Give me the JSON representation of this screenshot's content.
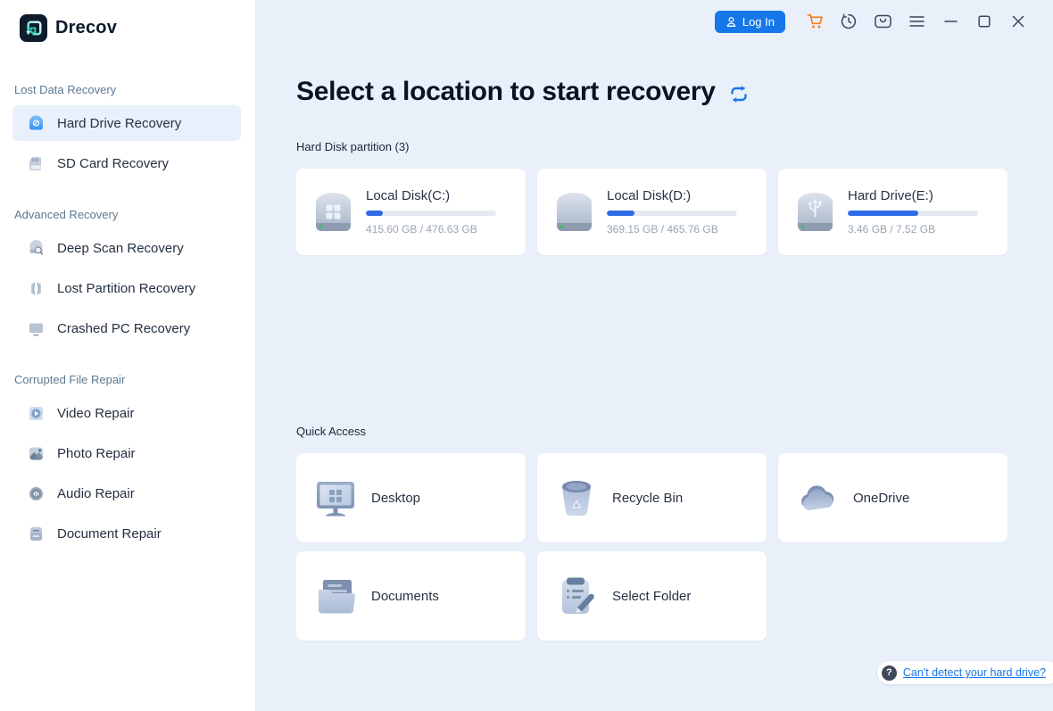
{
  "app": {
    "name": "Drecov"
  },
  "topbar": {
    "login": {
      "label": "Log In",
      "icon": "user-icon"
    },
    "icons": [
      {
        "name": "cart-icon",
        "color": "#f08119"
      },
      {
        "name": "history-clock-icon"
      },
      {
        "name": "messages-icon"
      },
      {
        "name": "menu-icon"
      },
      {
        "name": "minimize-icon"
      },
      {
        "name": "maximize-icon"
      },
      {
        "name": "close-icon"
      }
    ]
  },
  "sidebar": {
    "sections": [
      {
        "label": "Lost Data Recovery",
        "items": [
          {
            "label": "Hard Drive Recovery",
            "icon": "hard-drive-icon",
            "selected": true
          },
          {
            "label": "SD Card Recovery",
            "icon": "sd-card-icon",
            "selected": false
          }
        ]
      },
      {
        "label": "Advanced Recovery",
        "items": [
          {
            "label": "Deep Scan Recovery",
            "icon": "deep-scan-icon",
            "selected": false
          },
          {
            "label": "Lost Partition Recovery",
            "icon": "partition-icon",
            "selected": false
          },
          {
            "label": "Crashed PC Recovery",
            "icon": "crashed-pc-icon",
            "selected": false
          }
        ]
      },
      {
        "label": "Corrupted File Repair",
        "items": [
          {
            "label": "Video Repair",
            "icon": "video-icon",
            "selected": false
          },
          {
            "label": "Photo Repair",
            "icon": "photo-icon",
            "selected": false
          },
          {
            "label": "Audio Repair",
            "icon": "audio-icon",
            "selected": false
          },
          {
            "label": "Document Repair",
            "icon": "document-icon",
            "selected": false
          }
        ]
      }
    ]
  },
  "main": {
    "title": "Select a location to start recovery",
    "partition": {
      "label": "Hard Disk partition (3)",
      "drives": [
        {
          "name": "Local Disk(C:)",
          "size": "415.60 GB / 476.63 GB",
          "used_percent": 13,
          "icon": "windows-drive-icon"
        },
        {
          "name": "Local Disk(D:)",
          "size": "369.15 GB / 465.76 GB",
          "used_percent": 21,
          "icon": "drive-icon"
        },
        {
          "name": "Hard Drive(E:)",
          "size": "3.46 GB / 7.52 GB",
          "used_percent": 54,
          "icon": "usb-drive-icon"
        }
      ]
    },
    "quick_access": {
      "label": "Quick Access",
      "items": [
        {
          "label": "Desktop",
          "icon": "desktop-icon"
        },
        {
          "label": "Recycle Bin",
          "icon": "recycle-bin-icon"
        },
        {
          "label": "OneDrive",
          "icon": "onedrive-icon"
        },
        {
          "label": "Documents",
          "icon": "documents-icon"
        },
        {
          "label": "Select Folder",
          "icon": "select-folder-icon"
        }
      ]
    },
    "help": {
      "label": "Can't detect your hard drive?",
      "icon": "question-icon"
    }
  },
  "colors": {
    "accent": "#1677e8",
    "cart": "#f08119",
    "progress_fill": "#2e6be6",
    "main_background": "#e9f0fa",
    "selected_item_background": "#e7f0fb"
  }
}
